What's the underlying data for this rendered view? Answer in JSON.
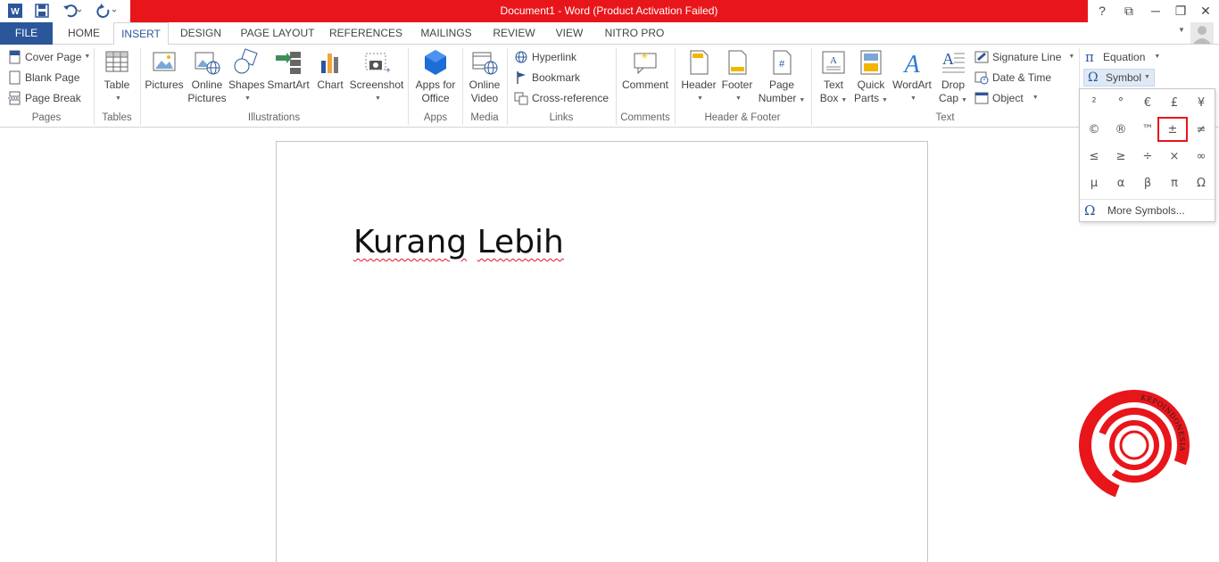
{
  "titlebar": {
    "title": "Document1 -  Word (Product Activation Failed)",
    "help": "?",
    "restore_ribbon": "⧉",
    "minimize": "─",
    "maximize": "❐",
    "close": "✕"
  },
  "tabs": {
    "file": "FILE",
    "home": "HOME",
    "insert": "INSERT",
    "design": "DESIGN",
    "page_layout": "PAGE LAYOUT",
    "references": "REFERENCES",
    "mailings": "MAILINGS",
    "review": "REVIEW",
    "view": "VIEW",
    "nitro": "NITRO PRO"
  },
  "ribbon": {
    "pages": {
      "label": "Pages",
      "cover": "Cover Page",
      "blank": "Blank Page",
      "break": "Page Break"
    },
    "tables": {
      "label": "Tables",
      "table": "Table"
    },
    "illustrations": {
      "label": "Illustrations",
      "pictures": "Pictures",
      "online1": "Online",
      "online2": "Pictures",
      "shapes": "Shapes",
      "smartart": "SmartArt",
      "chart": "Chart",
      "screenshot": "Screenshot"
    },
    "apps": {
      "label": "Apps",
      "apps1": "Apps for",
      "apps2": "Office"
    },
    "media": {
      "label": "Media",
      "video1": "Online",
      "video2": "Video"
    },
    "links": {
      "label": "Links",
      "hyperlink": "Hyperlink",
      "bookmark": "Bookmark",
      "crossref": "Cross-reference"
    },
    "comments": {
      "label": "Comments",
      "comment": "Comment"
    },
    "header_footer": {
      "label": "Header & Footer",
      "header": "Header",
      "footer": "Footer",
      "pagenum1": "Page",
      "pagenum2": "Number"
    },
    "text": {
      "label": "Text",
      "textbox1": "Text",
      "textbox2": "Box",
      "quick1": "Quick",
      "quick2": "Parts",
      "wordart": "WordArt",
      "drop1": "Drop",
      "drop2": "Cap",
      "signature": "Signature Line",
      "datetime": "Date & Time",
      "object": "Object"
    },
    "symbols": {
      "equation": "Equation",
      "symbol": "Symbol"
    }
  },
  "document": {
    "word1": "Kurang",
    "word2": "Lebih"
  },
  "symbol_menu": {
    "symbols": [
      "²",
      "°",
      "€",
      "£",
      "¥",
      "©",
      "®",
      "™",
      "±",
      "≠",
      "≤",
      "≥",
      "÷",
      "×",
      "∞",
      "µ",
      "α",
      "β",
      "π",
      "Ω"
    ],
    "more": "More Symbols..."
  },
  "watermark": {
    "text": "KEPOINDONESIA"
  },
  "colors": {
    "title_red": "#e8161b",
    "word_blue": "#2b579a",
    "highlight": "#e8161b"
  }
}
